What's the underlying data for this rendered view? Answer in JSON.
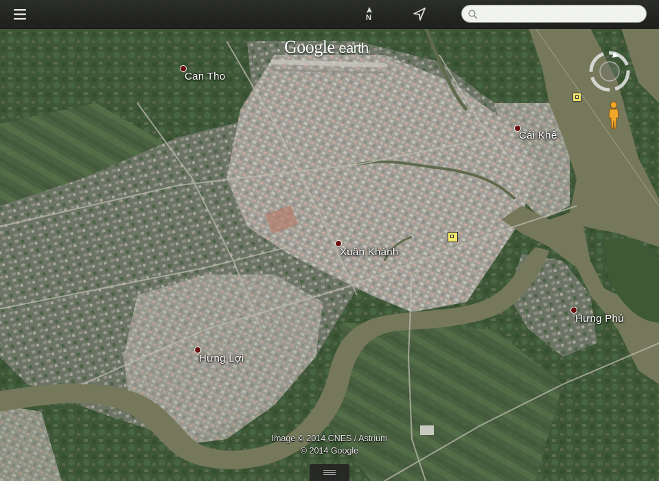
{
  "search": {
    "placeholder": "",
    "value": ""
  },
  "toolbar": {
    "north_label": "N"
  },
  "logo": {
    "google": "Google",
    "earth": "earth"
  },
  "places": [
    {
      "name": "Can Tho"
    },
    {
      "name": "Cái Khế"
    },
    {
      "name": "Xuân Khánh"
    },
    {
      "name": "Hưng Phú"
    },
    {
      "name": "Hưng Lợi"
    }
  ],
  "credits": {
    "line1": "Image © 2014 CNES / Astrium",
    "line2": "© 2014 Google"
  },
  "icons": {
    "menu": "menu-icon",
    "north": "north-arrow-icon",
    "locate": "location-arrow-icon",
    "search": "search-icon",
    "compass": "compass-icon",
    "pegman": "pegman-icon",
    "poi": "poi-square-icon"
  },
  "colors": {
    "river": "#75785a",
    "urban": "#a6a49c",
    "vegetation": "#3f5a38",
    "pin": "#6b0d0d",
    "poi": "#f3e76d",
    "pegman": "#f2a62a"
  }
}
